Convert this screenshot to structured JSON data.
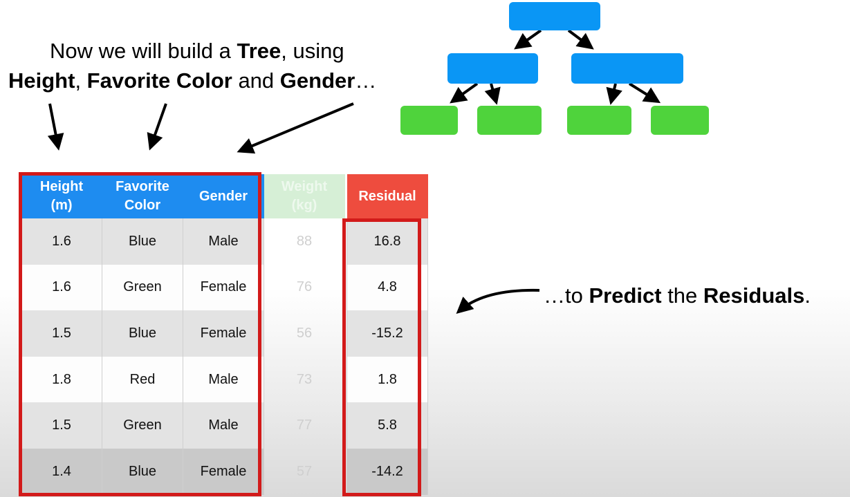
{
  "caption": {
    "line1": {
      "before": "Now we will build a ",
      "bold": "Tree",
      "after": ", using"
    },
    "line2": {
      "bold1": "Height",
      "sep1": ", ",
      "bold2": "Favorite Color",
      "sep2": " and ",
      "bold3": "Gender",
      "after": "…"
    },
    "predict": {
      "before": "…to ",
      "bold1": "Predict",
      "middle": " the ",
      "bold2": "Residuals",
      "after": "."
    }
  },
  "table": {
    "headers": {
      "height": [
        "Height",
        "(m)"
      ],
      "color": [
        "Favorite",
        "Color"
      ],
      "gender": "Gender",
      "weight": [
        "Weight",
        "(kg)"
      ],
      "residual": "Residual"
    },
    "rows": [
      {
        "height": "1.6",
        "color": "Blue",
        "gender": "Male",
        "weight": "88",
        "residual": "16.8"
      },
      {
        "height": "1.6",
        "color": "Green",
        "gender": "Female",
        "weight": "76",
        "residual": "4.8"
      },
      {
        "height": "1.5",
        "color": "Blue",
        "gender": "Female",
        "weight": "56",
        "residual": "-15.2"
      },
      {
        "height": "1.8",
        "color": "Red",
        "gender": "Male",
        "weight": "73",
        "residual": "1.8"
      },
      {
        "height": "1.5",
        "color": "Green",
        "gender": "Male",
        "weight": "77",
        "residual": "5.8"
      },
      {
        "height": "1.4",
        "color": "Blue",
        "gender": "Female",
        "weight": "57",
        "residual": "-14.2"
      }
    ]
  },
  "colors": {
    "header_blue": "#1e8cf0",
    "node_blue": "#0a96f5",
    "leaf_green": "#4fd33c",
    "highlight_red": "#d21a1a",
    "residual_header": "#ee4c3e",
    "weight_header": "#d6efd6"
  }
}
